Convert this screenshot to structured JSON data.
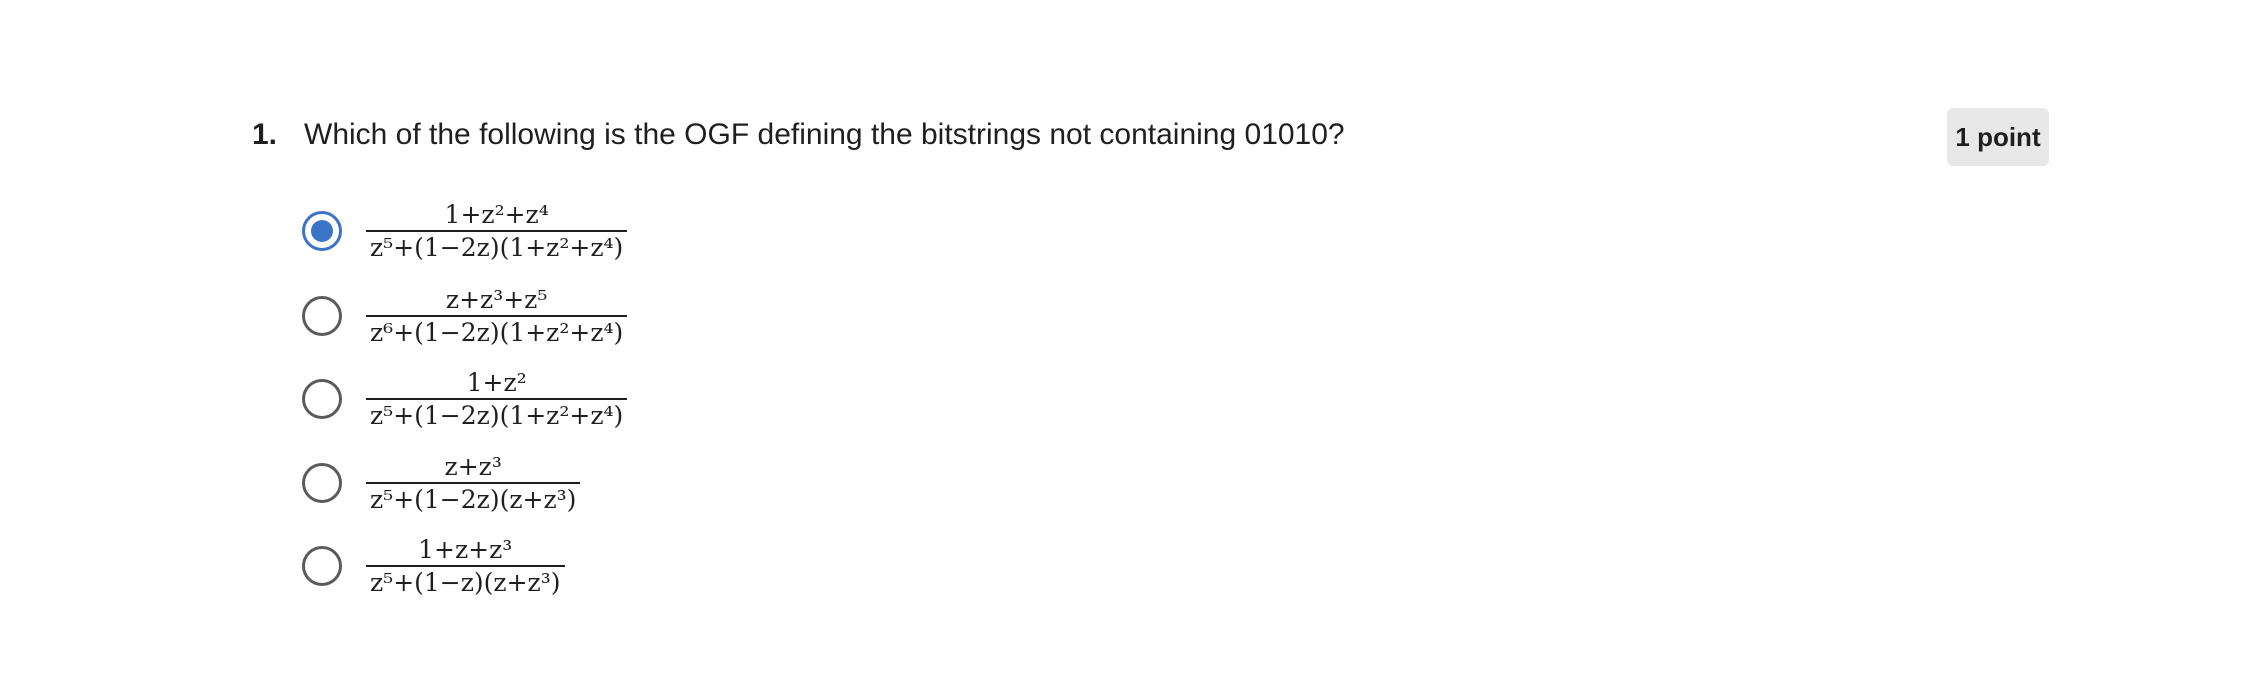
{
  "question": {
    "number": "1.",
    "text": "Which of the following is the OGF defining the bitstrings not containing 01010?",
    "points": "1 point"
  },
  "options": [
    {
      "selected": true,
      "numerator": "1+z²+z⁴",
      "denominator": "z⁵+(1−2z)(1+z²+z⁴)"
    },
    {
      "selected": false,
      "numerator": "z+z³+z⁵",
      "denominator": "z⁶+(1−2z)(1+z²+z⁴)"
    },
    {
      "selected": false,
      "numerator": "1+z²",
      "denominator": "z⁵+(1−2z)(1+z²+z⁴)"
    },
    {
      "selected": false,
      "numerator": "z+z³",
      "denominator": "z⁵+(1−2z)(z+z³)"
    },
    {
      "selected": false,
      "numerator": "1+z+z³",
      "denominator": "z⁵+(1−z)(z+z³)"
    }
  ],
  "colors": {
    "radio_selected": "#3b73c7",
    "radio_unselected": "#5b5b5b",
    "points_badge_bg": "#e8e8e8"
  }
}
